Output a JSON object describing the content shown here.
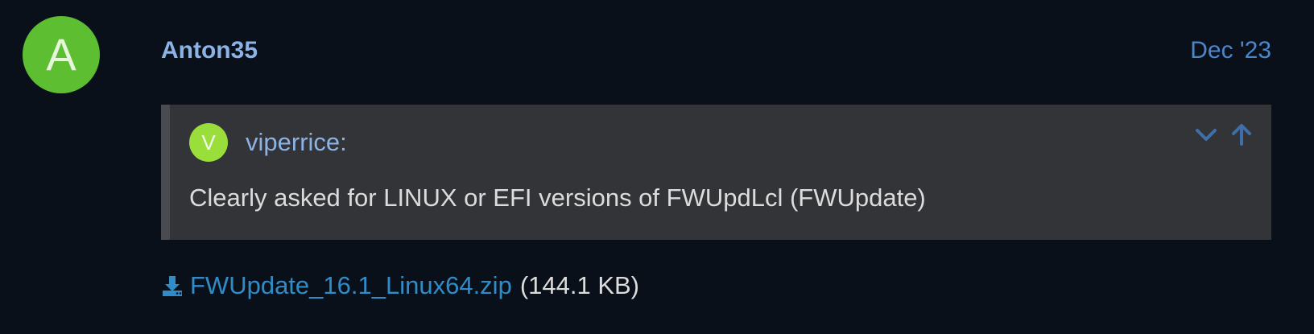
{
  "post": {
    "avatar_letter": "A",
    "avatar_color": "#5dbe32",
    "username": "Anton35",
    "date": "Dec '23"
  },
  "quote": {
    "avatar_letter": "V",
    "avatar_color": "#9ade3c",
    "author": "viperrice:",
    "text": "Clearly asked for LINUX or EFI versions of FWUpdLcl (FWUpdate)",
    "controls": [
      "chevron-down-icon",
      "arrow-up-icon"
    ]
  },
  "attachment": {
    "icon": "download-icon",
    "filename": "FWUpdate_16.1_Linux64.zip",
    "size": "(144.1 KB)"
  }
}
